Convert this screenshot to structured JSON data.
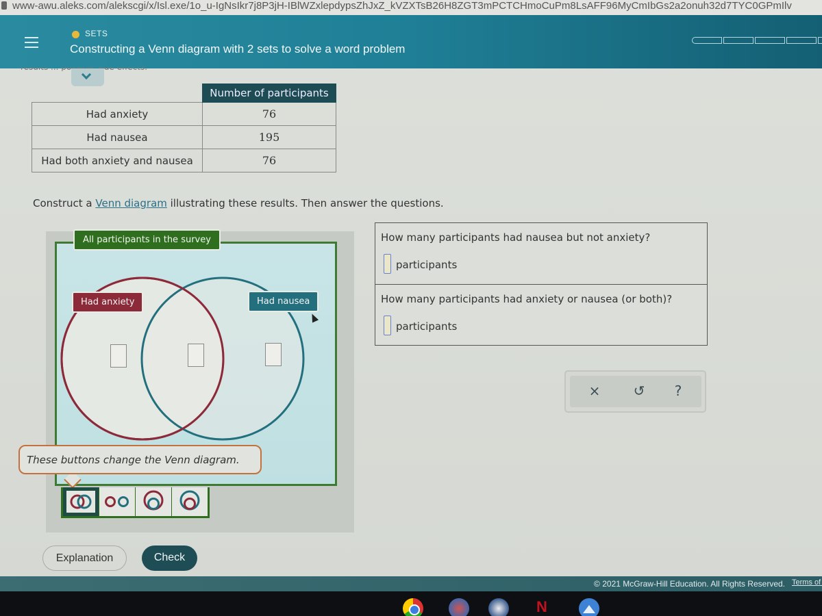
{
  "browser": {
    "url": "www-awu.aleks.com/alekscgi/x/Isl.exe/1o_u-IgNsIkr7j8P3jH-IBlWZxlepdypsZhJxZ_kVZXTsB26H8ZGT3mPCTCHmoCuPm8LsAFF96MyCmIbGs2a2onuh32d7TYC0GPmIlv"
  },
  "header": {
    "topic": "SETS",
    "title": "Constructing a Venn diagram with 2 sets to solve a word problem",
    "progress_segments": 5
  },
  "collapsed_text": "results ... possible side effects.",
  "table": {
    "column_header": "Number of participants",
    "rows": [
      {
        "label": "Had anxiety",
        "value": "76"
      },
      {
        "label": "Had nausea",
        "value": "195"
      },
      {
        "label": "Had both anxiety and nausea",
        "value": "76"
      }
    ]
  },
  "instruction": {
    "before": "Construct a ",
    "link": "Venn diagram",
    "after": " illustrating these results. Then answer the questions."
  },
  "venn": {
    "universe_label": "All participants in the survey",
    "set_a_label": "Had anxiety",
    "set_b_label": "Had nausea",
    "inputs": {
      "a_only": "",
      "both": "",
      "b_only": ""
    },
    "colors": {
      "set_a": "#8c2a3a",
      "set_b": "#236f7e",
      "universe": "#2f6d1f"
    }
  },
  "tooltip": "These buttons change the Venn diagram.",
  "diagram_types": [
    {
      "name": "overlapping",
      "selected": true
    },
    {
      "name": "disjoint",
      "selected": false
    },
    {
      "name": "nausea-inside-anxiety",
      "selected": false
    },
    {
      "name": "anxiety-inside-nausea",
      "selected": false
    }
  ],
  "questions": [
    {
      "text": "How many participants had nausea but not anxiety?",
      "value": "",
      "unit": "participants"
    },
    {
      "text": "How many participants had anxiety or nausea (or both)?",
      "value": "",
      "unit": "participants"
    }
  ],
  "tools": {
    "clear": "×",
    "undo": "↺",
    "help": "?"
  },
  "buttons": {
    "explanation": "Explanation",
    "check": "Check"
  },
  "footer": {
    "copyright": "© 2021 McGraw-Hill Education. All Rights Reserved.",
    "terms": "Terms of Use"
  },
  "taskbar": {
    "apps": [
      "chrome",
      "game",
      "solitaire",
      "netflix",
      "photos"
    ],
    "netflix_glyph": "N"
  }
}
